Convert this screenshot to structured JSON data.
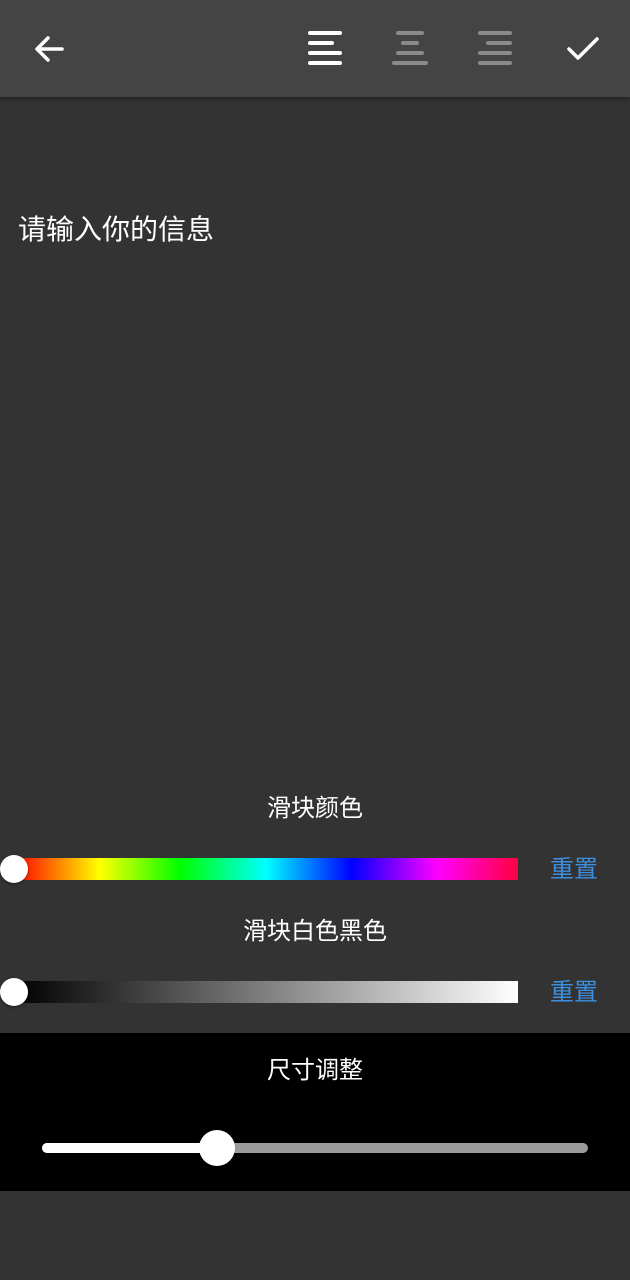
{
  "toolbar": {
    "icons": [
      "back-arrow-icon",
      "align-left-icon",
      "align-center-icon",
      "align-right-icon",
      "checkmark-icon"
    ],
    "active_align": "left"
  },
  "editor": {
    "placeholder": "请输入你的信息"
  },
  "slider_color": {
    "label": "滑块颜色",
    "reset_label": "重置",
    "value_fraction": 0.0
  },
  "slider_bw": {
    "label": "滑块白色黑色",
    "reset_label": "重置",
    "value_fraction": 0.0
  },
  "size_adjust": {
    "label": "尺寸调整",
    "value_fraction": 0.32
  },
  "colors": {
    "background": "#333333",
    "toolbar": "#444444",
    "accent_link": "#3b8fe0",
    "size_panel": "#000000"
  }
}
